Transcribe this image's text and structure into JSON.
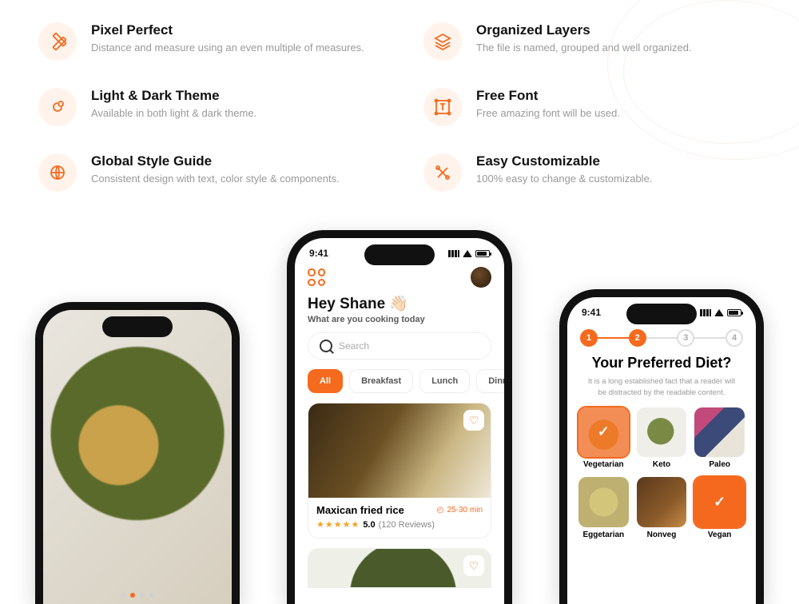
{
  "features": [
    {
      "title": "Pixel Perfect",
      "desc": "Distance and measure using an even multiple of measures."
    },
    {
      "title": "Organized Layers",
      "desc": "The file is named, grouped and well organized."
    },
    {
      "title": "Light & Dark Theme",
      "desc": "Available in both light & dark theme."
    },
    {
      "title": "Free Font",
      "desc": "Free amazing font will be used."
    },
    {
      "title": "Global Style Guide",
      "desc": "Consistent design with text, color style & components."
    },
    {
      "title": "Easy Customizable",
      "desc": "100% easy to change & customizable."
    }
  ],
  "status": {
    "time": "9:41"
  },
  "home": {
    "greeting": "Hey Shane 👋🏻",
    "subgreeting": "What are you cooking today",
    "search_placeholder": "Search",
    "categories": [
      "All",
      "Breakfast",
      "Lunch",
      "Dinner"
    ],
    "recipe": {
      "title": "Maxican fried rice",
      "minutes": "25-30 min",
      "rating": "5.0",
      "reviews": "(120 Reviews)"
    }
  },
  "onboard": {
    "steps": [
      "1",
      "2",
      "3",
      "4"
    ],
    "title": "Your Preferred Diet?",
    "sub": "It is a long established fact that a reader will be distracted by the readable content.",
    "diets": [
      "Vegetarian",
      "Keto",
      "Paleo",
      "Eggetarian",
      "Nonveg",
      "Vegan"
    ]
  }
}
